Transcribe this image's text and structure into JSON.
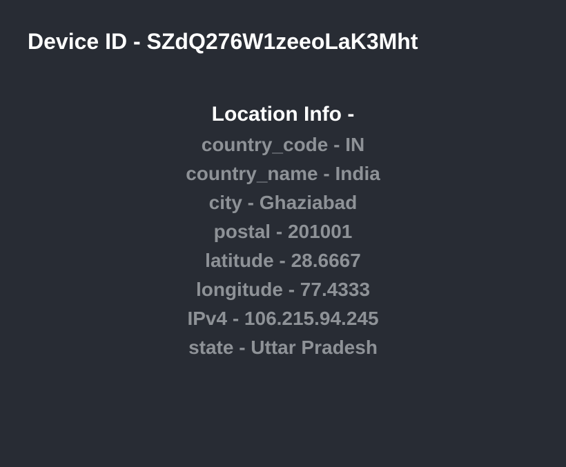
{
  "title": "Device ID - SZdQ276W1zeeoLaK3Mht",
  "location": {
    "heading": "Location Info -",
    "lines": {
      "country_code": "country_code - IN",
      "country_name": "country_name - India",
      "city": "city - Ghaziabad",
      "postal": "postal - 201001",
      "latitude": "latitude - 28.6667",
      "longitude": "longitude - 77.4333",
      "ipv4": "IPv4 - 106.215.94.245",
      "state": "state - Uttar Pradesh"
    }
  }
}
